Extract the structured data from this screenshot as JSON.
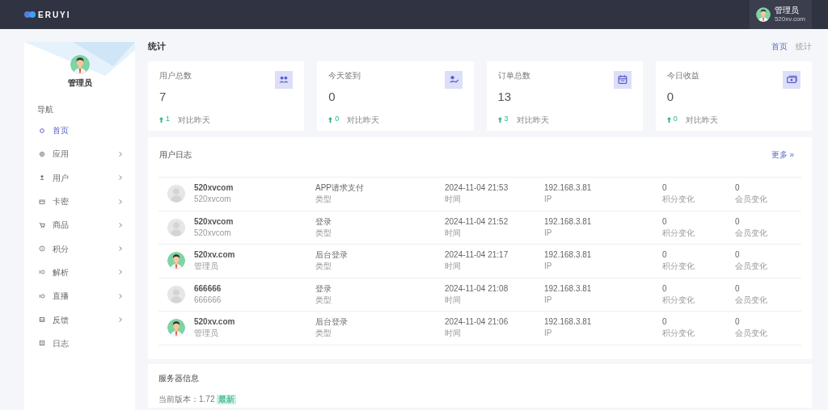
{
  "header": {
    "logo": "ERUYI",
    "user": {
      "name": "管理员",
      "site": "520xv.com"
    }
  },
  "sidebar": {
    "user_name": "管理员",
    "section": "导航",
    "items": [
      {
        "label": "首页",
        "selected": true,
        "expandable": false
      },
      {
        "label": "应用",
        "selected": false,
        "expandable": true
      },
      {
        "label": "用户",
        "selected": false,
        "expandable": true
      },
      {
        "label": "卡密",
        "selected": false,
        "expandable": true
      },
      {
        "label": "商品",
        "selected": false,
        "expandable": true
      },
      {
        "label": "积分",
        "selected": false,
        "expandable": true
      },
      {
        "label": "解析",
        "selected": false,
        "expandable": true
      },
      {
        "label": "直播",
        "selected": false,
        "expandable": true
      },
      {
        "label": "反馈",
        "selected": false,
        "expandable": true
      },
      {
        "label": "日志",
        "selected": false,
        "expandable": false
      }
    ]
  },
  "page_title": "统计",
  "breadcrumb": [
    "首页",
    "统计"
  ],
  "stats": [
    {
      "label": "用户总数",
      "value": "7",
      "change": "1",
      "compare": "对比昨天"
    },
    {
      "label": "今天签到",
      "value": "0",
      "change": "0",
      "compare": "对比昨天"
    },
    {
      "label": "订单总数",
      "value": "13",
      "change": "3",
      "compare": "对比昨天"
    },
    {
      "label": "今日收益",
      "value": "0",
      "change": "0",
      "compare": "对比昨天"
    }
  ],
  "user_log": {
    "title": "用户日志",
    "more": "更多 »",
    "rows": [
      {
        "kind": "default",
        "name": "520xvcom",
        "sub": "520xvcom",
        "type": "APP请求支付",
        "type_label": "类型",
        "time": "2024-11-04 21:53",
        "time_label": "时间",
        "ip": "192.168.3.81",
        "ip_label": "IP",
        "points": "0",
        "points_label": "积分变化",
        "vip": "0",
        "vip_label": "会员变化"
      },
      {
        "kind": "default",
        "name": "520xvcom",
        "sub": "520xvcom",
        "type": "登录",
        "type_label": "类型",
        "time": "2024-11-04 21:52",
        "time_label": "时间",
        "ip": "192.168.3.81",
        "ip_label": "IP",
        "points": "0",
        "points_label": "积分变化",
        "vip": "0",
        "vip_label": "会员变化"
      },
      {
        "kind": "admin",
        "name": "520xv.com",
        "sub": "管理员",
        "type": "后台登录",
        "type_label": "类型",
        "time": "2024-11-04 21:17",
        "time_label": "时间",
        "ip": "192.168.3.81",
        "ip_label": "IP",
        "points": "0",
        "points_label": "积分变化",
        "vip": "0",
        "vip_label": "会员变化"
      },
      {
        "kind": "default",
        "name": "666666",
        "sub": "666666",
        "type": "登录",
        "type_label": "类型",
        "time": "2024-11-04 21:08",
        "time_label": "时间",
        "ip": "192.168.3.81",
        "ip_label": "IP",
        "points": "0",
        "points_label": "积分变化",
        "vip": "0",
        "vip_label": "会员变化"
      },
      {
        "kind": "admin",
        "name": "520xv.com",
        "sub": "管理员",
        "type": "后台登录",
        "type_label": "类型",
        "time": "2024-11-04 21:06",
        "time_label": "时间",
        "ip": "192.168.3.81",
        "ip_label": "IP",
        "points": "0",
        "points_label": "积分变化",
        "vip": "0",
        "vip_label": "会员变化"
      }
    ]
  },
  "server_info": {
    "title": "服务器信息",
    "version_label": "当前版本：1.72",
    "badge": "最新"
  }
}
